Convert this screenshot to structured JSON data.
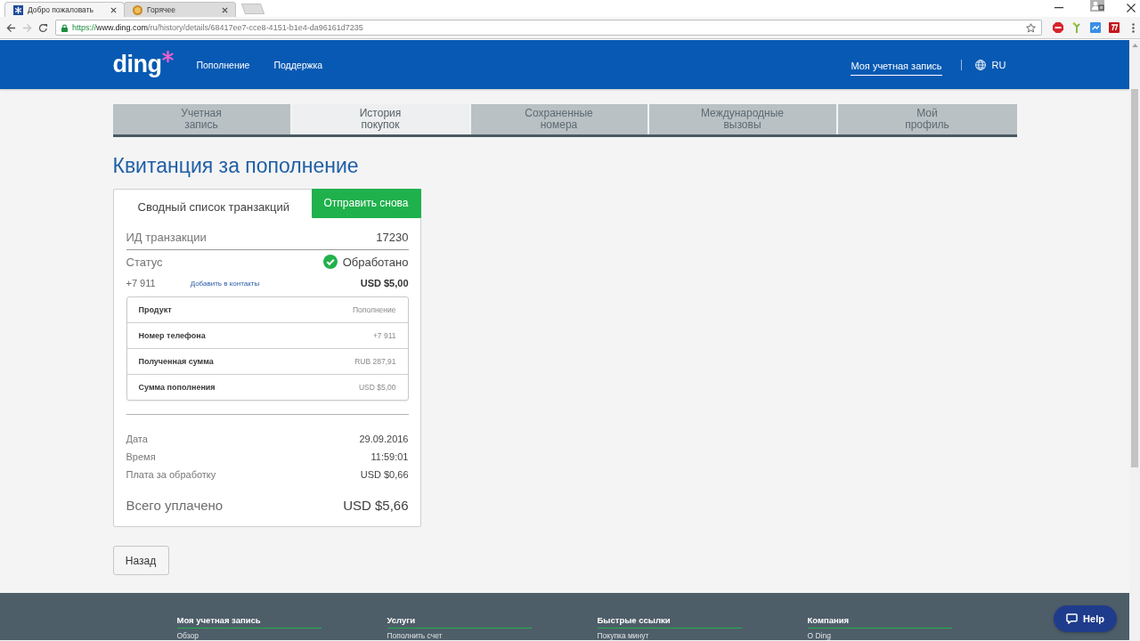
{
  "browser": {
    "tabs": [
      {
        "title": "Добро пожаловать",
        "selected": true
      },
      {
        "title": "Горячее",
        "selected": false
      }
    ],
    "url": {
      "scheme": "https://",
      "host": "www.ding.com",
      "path": "/ru/history/details/68417ee7-cce8-4151-b1e4-da96161d7235"
    }
  },
  "header": {
    "logo": "ding",
    "nav": [
      "Пополнение",
      "Поддержка"
    ],
    "account_link": "Моя учетная запись",
    "language": "RU"
  },
  "account_tabs": [
    {
      "label": "Учетная запись",
      "selected": false
    },
    {
      "label": "История покупок",
      "selected": true
    },
    {
      "label": "Сохраненные номера",
      "selected": false
    },
    {
      "label": "Международные вызовы",
      "selected": false
    },
    {
      "label": "Мой профиль",
      "selected": false
    }
  ],
  "page_title": "Квитанция за пополнение",
  "receipt": {
    "heading": "Сводный список транзакций",
    "resend_button": "Отправить снова",
    "transaction_id": {
      "label": "ИД транзакции",
      "value": "17230"
    },
    "status": {
      "label": "Статус",
      "value": "Обработано"
    },
    "recipient": {
      "phone": "+7 911",
      "link": "Добавить в контакты",
      "amount": "USD $5,00"
    },
    "details": [
      {
        "label": "Продукт",
        "value": "Пополнение"
      },
      {
        "label": "Номер телефона",
        "value": "+7 911"
      },
      {
        "label": "Полученная сумма",
        "value": "RUB 287,91"
      },
      {
        "label": "Сумма пополнения",
        "value": "USD $5,00"
      }
    ],
    "charges": [
      {
        "label": "Дата",
        "value": "29.09.2016"
      },
      {
        "label": "Время",
        "value": "11:59:01"
      },
      {
        "label": "Плата за обработку",
        "value": "USD $0,66"
      }
    ],
    "total": {
      "label": "Всего уплачено",
      "value": "USD $5,66"
    }
  },
  "back_button": "Назад",
  "footer": {
    "columns": [
      {
        "heading": "Моя учетная запись",
        "link": "Обзор"
      },
      {
        "heading": "Услуги",
        "link": "Пополнить счет"
      },
      {
        "heading": "Быстрые ссылки",
        "link": "Покупка минут"
      },
      {
        "heading": "Компания",
        "link": "О Ding"
      }
    ]
  },
  "help_button": "Help"
}
